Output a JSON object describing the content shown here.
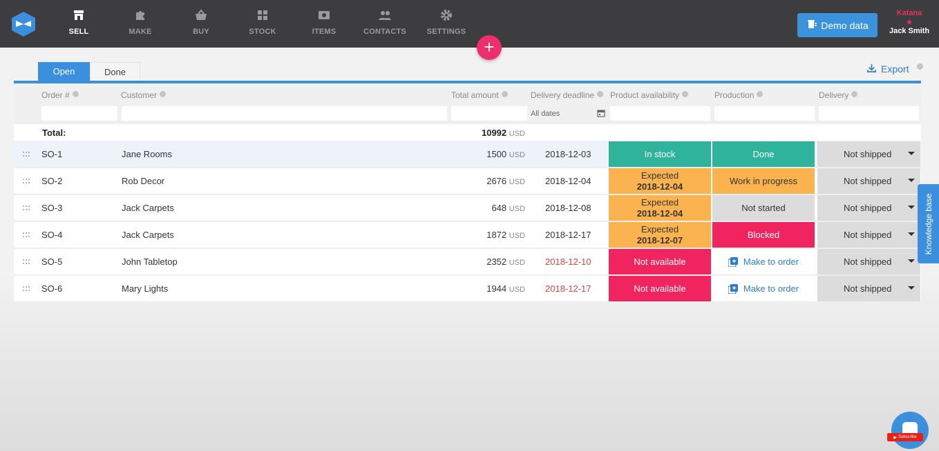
{
  "app": {
    "company": "Katana",
    "user_name": "Jack Smith",
    "demo_button": "Demo data",
    "fab_label": "+"
  },
  "nav": [
    {
      "label": "SELL",
      "icon": "shop-icon",
      "active": true
    },
    {
      "label": "MAKE",
      "icon": "puzzle-icon",
      "active": false
    },
    {
      "label": "BUY",
      "icon": "basket-icon",
      "active": false
    },
    {
      "label": "STOCK",
      "icon": "stock-icon",
      "active": false
    },
    {
      "label": "ITEMS",
      "icon": "items-icon",
      "active": false
    },
    {
      "label": "CONTACTS",
      "icon": "people-icon",
      "active": false
    },
    {
      "label": "SETTINGS",
      "icon": "gear-icon",
      "active": false
    }
  ],
  "tabs": {
    "open": "Open",
    "done": "Done"
  },
  "export_label": "Export",
  "columns": {
    "order": "Order #",
    "customer": "Customer",
    "total": "Total amount",
    "deadline": "Delivery deadline",
    "availability": "Product availability",
    "production": "Production",
    "delivery": "Delivery"
  },
  "filters": {
    "date_placeholder": "All dates"
  },
  "total": {
    "label": "Total:",
    "amount": "10992",
    "currency": "USD"
  },
  "orders": [
    {
      "order": "SO-1",
      "customer": "Jane Rooms",
      "amount": "1500",
      "currency": "USD",
      "deadline": "2018-12-03",
      "late": false,
      "availability": {
        "text": "In stock",
        "date": "",
        "status": "green"
      },
      "production": {
        "text": "Done",
        "status": "green"
      },
      "delivery": "Not shipped"
    },
    {
      "order": "SO-2",
      "customer": "Rob Decor",
      "amount": "2676",
      "currency": "USD",
      "deadline": "2018-12-04",
      "late": false,
      "availability": {
        "text": "Expected",
        "date": "2018-12-04",
        "status": "orange"
      },
      "production": {
        "text": "Work in progress",
        "status": "orange"
      },
      "delivery": "Not shipped"
    },
    {
      "order": "SO-3",
      "customer": "Jack Carpets",
      "amount": "648",
      "currency": "USD",
      "deadline": "2018-12-08",
      "late": false,
      "availability": {
        "text": "Expected",
        "date": "2018-12-04",
        "status": "orange"
      },
      "production": {
        "text": "Not started",
        "status": "grey"
      },
      "delivery": "Not shipped"
    },
    {
      "order": "SO-4",
      "customer": "Jack Carpets",
      "amount": "1872",
      "currency": "USD",
      "deadline": "2018-12-17",
      "late": false,
      "availability": {
        "text": "Expected",
        "date": "2018-12-07",
        "status": "orange"
      },
      "production": {
        "text": "Blocked",
        "status": "red"
      },
      "delivery": "Not shipped"
    },
    {
      "order": "SO-5",
      "customer": "John Tabletop",
      "amount": "2352",
      "currency": "USD",
      "deadline": "2018-12-10",
      "late": true,
      "availability": {
        "text": "Not available",
        "date": "",
        "status": "red"
      },
      "production": {
        "text": "Make to order",
        "status": "link"
      },
      "delivery": "Not shipped"
    },
    {
      "order": "SO-6",
      "customer": "Mary Lights",
      "amount": "1944",
      "currency": "USD",
      "deadline": "2018-12-17",
      "late": true,
      "availability": {
        "text": "Not available",
        "date": "",
        "status": "red"
      },
      "production": {
        "text": "Make to order",
        "status": "link"
      },
      "delivery": "Not shipped"
    }
  ],
  "knowledge_base": "Knowledge base",
  "yt_badge": "Subscribe",
  "colors": {
    "topbar": "#3d3d3f",
    "accent_blue": "#3b8fdc",
    "fab_pink": "#ee2f6b",
    "status_green": "#2fb39a",
    "status_orange": "#fbb34f",
    "status_red": "#f0245f",
    "status_grey": "#dcdcdc",
    "late_date": "#d9463f"
  }
}
